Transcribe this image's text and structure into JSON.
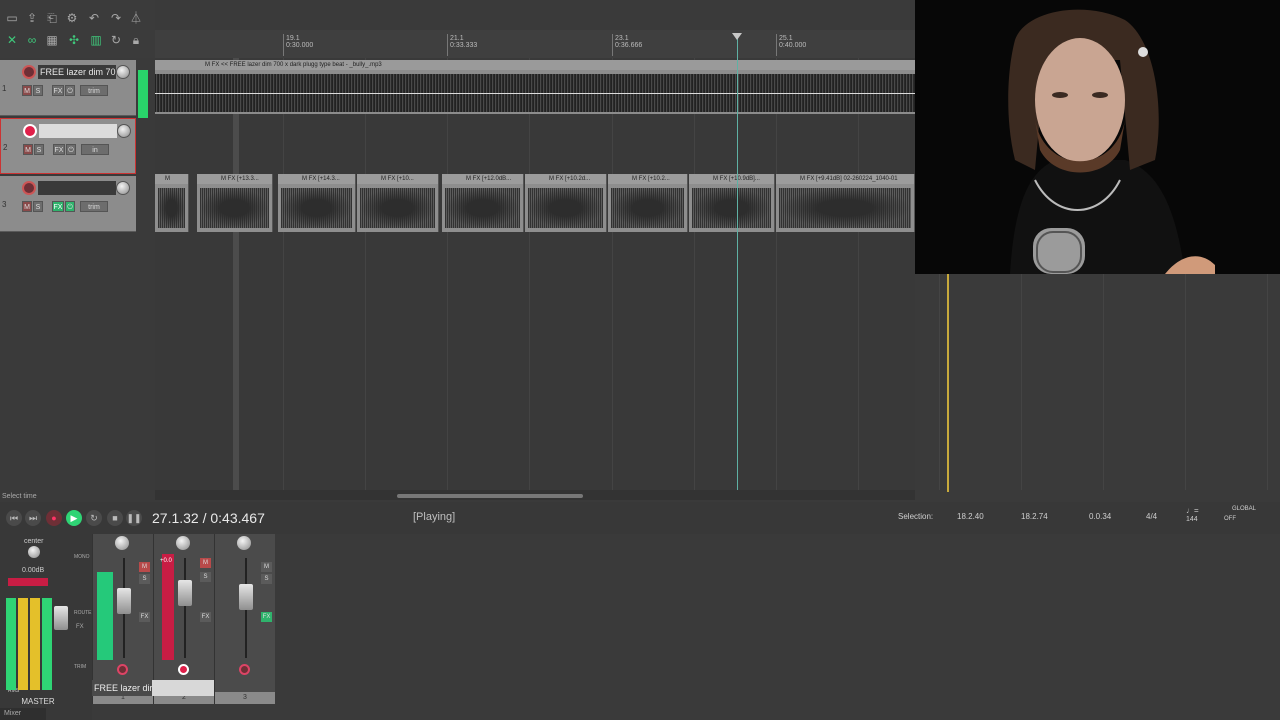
{
  "toolbar": {
    "icons": [
      "new-project-icon",
      "open-project-icon",
      "save-icon",
      "settings-icon",
      "undo-icon",
      "redo-icon",
      "metronome-icon",
      "ripple-edit-icon",
      "loop-icon",
      "grid-icon",
      "snap-icon",
      "auto-crossfade-icon",
      "repeat-icon",
      "lock-icon"
    ]
  },
  "ruler": {
    "marks": [
      {
        "bar": "19.1",
        "time": "0:30.000"
      },
      {
        "bar": "21.1",
        "time": "0:33.333"
      },
      {
        "bar": "23.1",
        "time": "0:36.666"
      },
      {
        "bar": "25.1",
        "time": "0:40.000"
      }
    ]
  },
  "tracks": [
    {
      "number": "1",
      "name": "FREE lazer dim 70",
      "fx": "FX",
      "io": "trim"
    },
    {
      "number": "2",
      "name": "",
      "fx": "FX",
      "io": "in"
    },
    {
      "number": "3",
      "name": "",
      "fx": "FX",
      "io": "trim"
    }
  ],
  "items": {
    "track1_label": "M  FX  << FREE lazer dim 700 x dark plugg type beat - _bully_.mp3",
    "track3_labels": [
      "M",
      "M  FX  [+13.3...",
      "M  FX  [+14.3...",
      "M  FX  [+10...",
      "M  FX  [+12.0dB...",
      "M  FX  [+10.2d...",
      "M  FX  [+10.2...",
      "M  FX  [+10.9dB]...",
      "M  FX  [+9.41dB] 02-260224_1040-01"
    ]
  },
  "status_hint": "Select time",
  "transport": {
    "time": "27.1.32 / 0:43.467",
    "status": "[Playing]",
    "selection_label": "Selection:",
    "selection_start": "18.2.40",
    "selection_end": "18.2.74",
    "selection_length": "0.0.34",
    "time_signature": "4/4",
    "bpm": "144",
    "global_label": "GLOBAL",
    "global_state": "OFF"
  },
  "mixer": {
    "master_pan": "center",
    "master_volume": "0.00dB",
    "master_label": "MASTER",
    "mono_label": "MONO",
    "route_label": "ROUTE",
    "fx_label": "FX",
    "trim_label": "TRIM",
    "rms_label": "RMS",
    "strip_numbers": [
      "1",
      "2",
      "3"
    ],
    "strip2_peak": "+0.0",
    "name_field": "FREE lazer dir",
    "tab_label": "Mixer"
  },
  "colors": {
    "accent_green": "#2fd475",
    "record_red": "#e0204a",
    "cursor": "#5fb1a4",
    "loop_marker": "#c8aa3c"
  }
}
